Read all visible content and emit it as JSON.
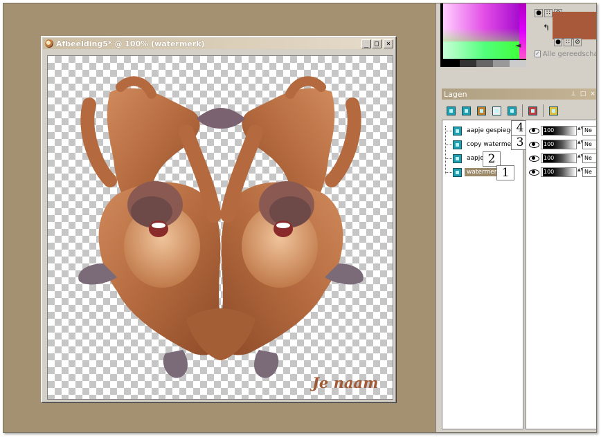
{
  "image_window": {
    "title": "Afbeelding5* @ 100% (watermerk)",
    "controls": {
      "minimize": "_",
      "maximize": "□",
      "close": "×"
    },
    "watermark_text": "Je naam"
  },
  "color_palette": {
    "all_tools_label": "Alle gereedschap",
    "accent_color": "#a8593a"
  },
  "layers_panel": {
    "title": "Lagen",
    "title_controls": {
      "pin": "⊥",
      "minimize": "□",
      "close": "×"
    },
    "layers": [
      {
        "name": "aapje gespiegeld",
        "number": "4",
        "opacity": "100",
        "blend": "Ne"
      },
      {
        "name": "copy watermerk",
        "number": "3",
        "opacity": "100",
        "blend": "Ne"
      },
      {
        "name": "aapje",
        "number": "2",
        "opacity": "100",
        "blend": "Ne"
      },
      {
        "name": "watermerk",
        "number": "1",
        "opacity": "100",
        "blend": "Ne",
        "selected": true
      }
    ],
    "toolbar_icons": [
      "new-raster-layer-icon",
      "new-vector-layer-icon",
      "new-art-media-layer-icon",
      "new-mask-layer-icon",
      "new-adjustment-layer-icon",
      "duplicate-layer-icon",
      "layer-properties-icon"
    ]
  },
  "colors": {
    "workspace": "#a39171",
    "selection": "#9c8a6a",
    "window_title": "#cdbea3"
  }
}
